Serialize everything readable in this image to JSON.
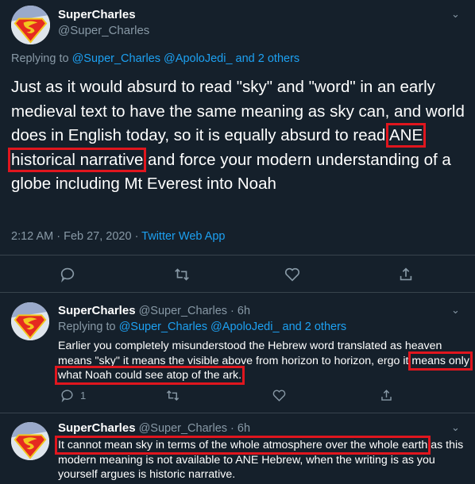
{
  "main_tweet": {
    "display_name": "SuperCharles",
    "handle": "@Super_Charles",
    "replying_prefix": "Replying to ",
    "replying_to": "@Super_Charles @ApoloJedi_ and 2 others",
    "text_before": "Just as it would absurd to read \"sky\" and \"word\" in an early medieval text to have the same meaning as sky can, and world does in English today, so it is equally absurd to read ",
    "text_highlight": "ANE historical narrative",
    "text_after": " and force your modern understanding of a globe including Mt Everest into Noah",
    "timestamp": "2:12 AM · Feb 27, 2020 · ",
    "source": "Twitter Web App"
  },
  "replies": [
    {
      "display_name": "SuperCharles",
      "handle_time": "@Super_Charles · 6h",
      "replying_prefix": "Replying to ",
      "replying_to": "@Super_Charles @ApoloJedi_ and 2 others",
      "text_before": "Earlier you completely misunderstood the Hebrew word translated as heaven means \"sky\" it means the visible above from horizon to horizon, ergo it ",
      "text_highlight": "means only what Noah could see atop of the ark.",
      "reply_count": "1"
    },
    {
      "display_name": "SuperCharles",
      "handle_time": "@Super_Charles · 6h",
      "text_highlight": "It cannot mean sky in terms of the whole atmosphere over the whole earth",
      "text_after": " as this modern meaning is not available to ANE Hebrew, when the writing is as you yourself argues is historic narrative."
    }
  ],
  "icons": [
    "superman-avatar",
    "chevron-down-icon",
    "reply-icon",
    "retweet-icon",
    "like-icon",
    "share-icon"
  ],
  "colors": {
    "background": "#15202b",
    "link": "#1da1f2",
    "muted": "#8899a6",
    "highlight_box": "#e0161e",
    "divider": "#38444d"
  }
}
